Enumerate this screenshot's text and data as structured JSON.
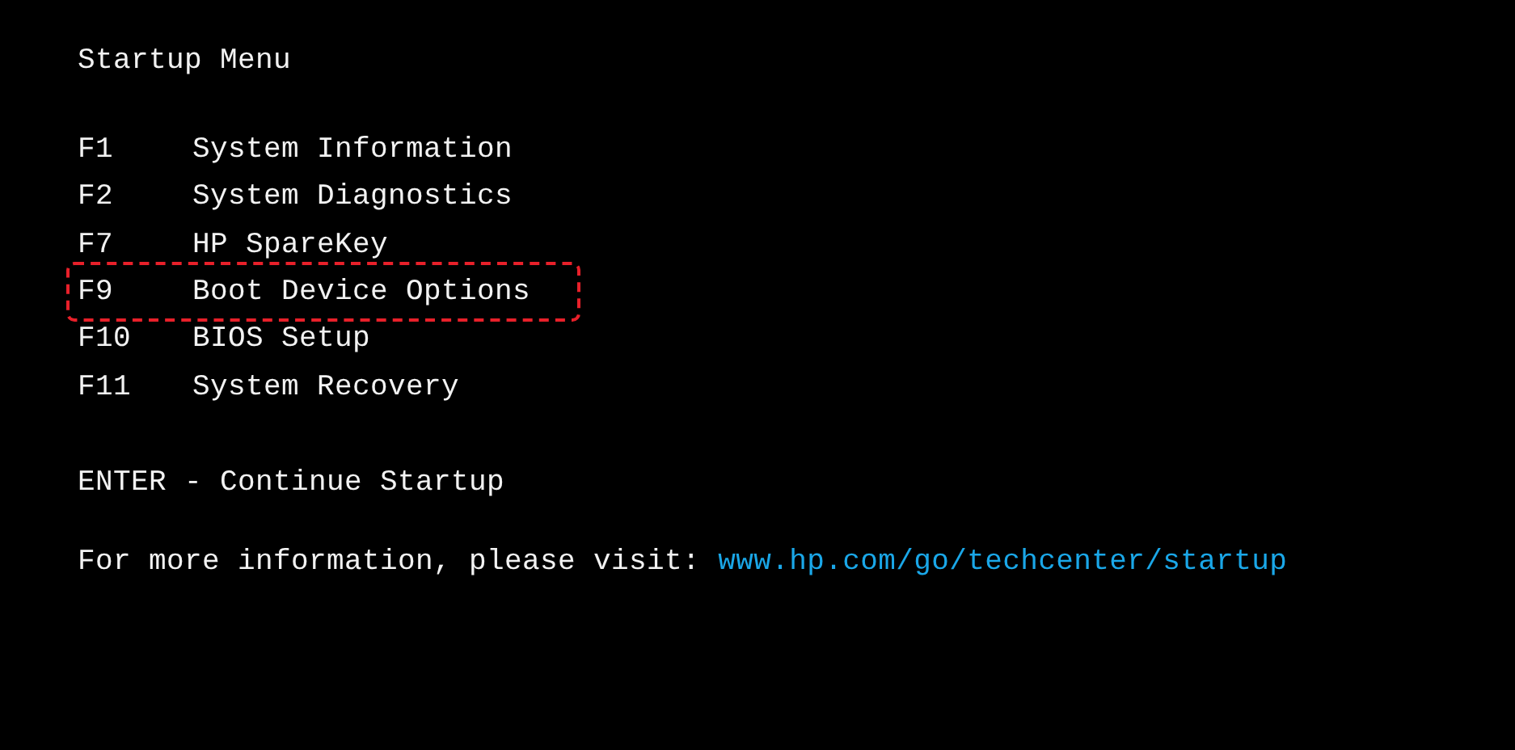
{
  "title": "Startup Menu",
  "options": [
    {
      "key": "F1",
      "label": "System Information",
      "highlighted": false
    },
    {
      "key": "F2",
      "label": "System Diagnostics",
      "highlighted": false
    },
    {
      "key": "F7",
      "label": "HP SpareKey",
      "highlighted": false
    },
    {
      "key": "F9",
      "label": "Boot Device Options",
      "highlighted": true
    },
    {
      "key": "F10",
      "label": "BIOS Setup",
      "highlighted": false
    },
    {
      "key": "F11",
      "label": "System Recovery",
      "highlighted": false
    }
  ],
  "continue": "ENTER - Continue Startup",
  "info": {
    "text": "For more information, please visit:",
    "link": "www.hp.com/go/techcenter/startup"
  }
}
